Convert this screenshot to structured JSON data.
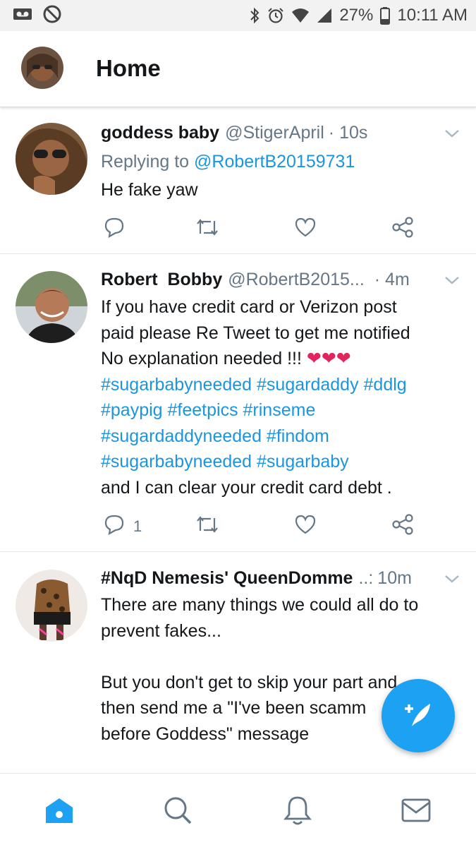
{
  "status_bar": {
    "battery": "27%",
    "time": "10:11 AM"
  },
  "header": {
    "title": "Home"
  },
  "tweets": [
    {
      "name": "goddess baby",
      "handle": "@StigerApril",
      "time": "· 10s",
      "reply_prefix": "Replying to",
      "reply_to": "@RobertB20159731",
      "text": "He fake yaw",
      "reply_count": ""
    },
    {
      "name": "Robert  Bobby",
      "handle": "@RobertB2015...",
      "time": "· 4m",
      "line1": "If you have credit card or Verizon post",
      "line2": "paid please Re Tweet to get me notified",
      "line3": "No explanation needed !!!",
      "hearts": "❤❤❤",
      "tags_line1": "#sugarbabyneeded #sugardaddy #ddlg",
      "tags_line2": "#paypig #feetpics #rinseme",
      "tags_line3": "#sugardaddyneeded #findom",
      "tags_line4": "#sugarbabyneeded #sugarbaby",
      "line_last": "and I can clear your credit card debt .",
      "reply_count": "1"
    },
    {
      "name": "#NqD Nemesis' QueenDomme",
      "handle": "..:",
      "time": "10m",
      "line1": "There are many things we could all do to",
      "line2": "prevent fakes...",
      "line3": "But you don't get to skip your part and",
      "line4": "then send me a \"I've been scamm",
      "line5": "before Goddess\" message"
    }
  ],
  "colors": {
    "accent": "#1da1f2",
    "link": "#1b95e0",
    "heart": "#e0245e",
    "secondary_text": "#657786"
  },
  "icons": {
    "status": [
      "voicemail-icon",
      "no-disturb-icon",
      "bluetooth-icon",
      "alarm-icon",
      "wifi-icon",
      "signal-icon",
      "battery-icon"
    ],
    "actions": [
      "reply-icon",
      "retweet-icon",
      "like-icon",
      "share-icon"
    ],
    "nav": [
      "home-icon",
      "search-icon",
      "notifications-icon",
      "messages-icon"
    ],
    "fab": "compose-icon"
  }
}
